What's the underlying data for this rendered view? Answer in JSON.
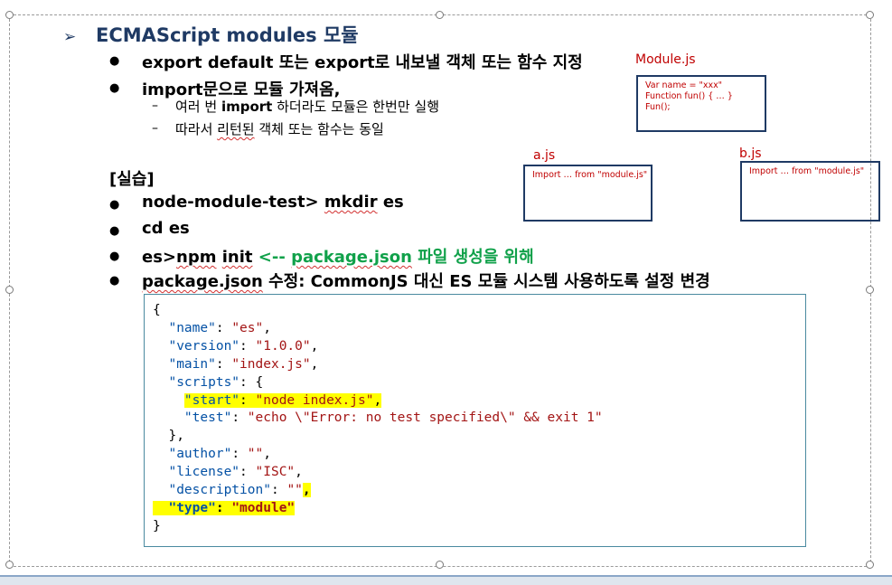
{
  "heading": {
    "arrow": "➢",
    "title": "ECMAScript modules 모듈"
  },
  "bullets": [
    "export default 또는 export로 내보낼 객체 또는 함수 지정",
    "import문으로 모듈 가져옴,"
  ],
  "subitems": [
    {
      "pre": "여러 번 ",
      "bold": "import",
      "post": " 하더라도 모듈은 한번만 실행"
    },
    {
      "pre": "따라서 ",
      "sq": "리턴된",
      "post": " 객체 또는 함수는 동일"
    }
  ],
  "practice": {
    "title": "[실습]",
    "item1": {
      "pre": "node-module-test> ",
      "sq": "mkdir",
      "post": " es"
    },
    "item2": "cd es",
    "item3": {
      "pre": "es>",
      "sq1": "npm",
      "mid": " ",
      "sq2": "init",
      "green_pre": " <-- ",
      "green_sq": "package.json",
      "green_post": " 파일 생성을 위해"
    },
    "item4": {
      "sq": "package.json",
      "post": " 수정: CommonJS 대신 ES 모듈 시스템 사용하도록 설정 변경"
    }
  },
  "diagram": {
    "module_label": "Module.js",
    "module_lines": [
      "Var name = \"xxx\"",
      "Function fun() { … }",
      "Fun();"
    ],
    "a_label": "a.js",
    "a_text": "Import … from \"module.js\"",
    "b_label": "b.js",
    "b_text": "Import … from \"module.js\""
  },
  "code": {
    "open": "{",
    "name_k": "\"name\"",
    "name_v": "\"es\"",
    "version_k": "\"version\"",
    "version_v": "\"1.0.0\"",
    "main_k": "\"main\"",
    "main_v": "\"index.js\"",
    "scripts_k": "\"scripts\"",
    "start_k": "\"start\"",
    "start_v": "\"node index.js\"",
    "test_k": "\"test\"",
    "test_v": "\"echo \\\"Error: no test specified\\\" && exit 1\"",
    "scripts_close": "},",
    "author_k": "\"author\"",
    "author_v": "\"\"",
    "license_k": "\"license\"",
    "license_v": "\"ISC\"",
    "description_k": "\"description\"",
    "description_v": "\"\"",
    "type_k": "\"type\"",
    "type_v": "\"module\"",
    "close": "}"
  }
}
